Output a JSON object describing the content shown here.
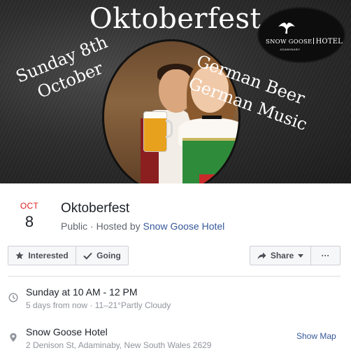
{
  "cover": {
    "title": "Oktoberfest",
    "date_text": "Sunday 8th\nOctober",
    "features_text": "German Beer\nGerman Music",
    "logo": {
      "name_left": "SNOW GOOSE",
      "name_right": "HOTEL",
      "sub": "ADAMINABY"
    }
  },
  "event": {
    "month": "OCT",
    "day": "8",
    "title": "Oktoberfest",
    "privacy": "Public",
    "separator": " · ",
    "hosted_prefix": "Hosted by ",
    "host": "Snow Goose Hotel"
  },
  "actions": {
    "interested_label": "Interested",
    "going_label": "Going",
    "share_label": "Share",
    "more_label": "···"
  },
  "details": {
    "time": "Sunday at 10 AM - 12 PM",
    "time_sub": "5 days from now · 11–21°Partly Cloudy",
    "place": "Snow Goose Hotel",
    "address": "2 Denison St, Adaminaby, New South Wales 2629",
    "map_link": "Show Map"
  },
  "colors": {
    "accent_red": "#e02020",
    "link_blue": "#365899",
    "button_bg": "#f6f7f9"
  },
  "icons": [
    "star-icon",
    "checkmark-icon",
    "share-arrow-icon",
    "caret-down-icon",
    "more-icon",
    "clock-icon",
    "location-pin-icon",
    "goose-icon"
  ]
}
